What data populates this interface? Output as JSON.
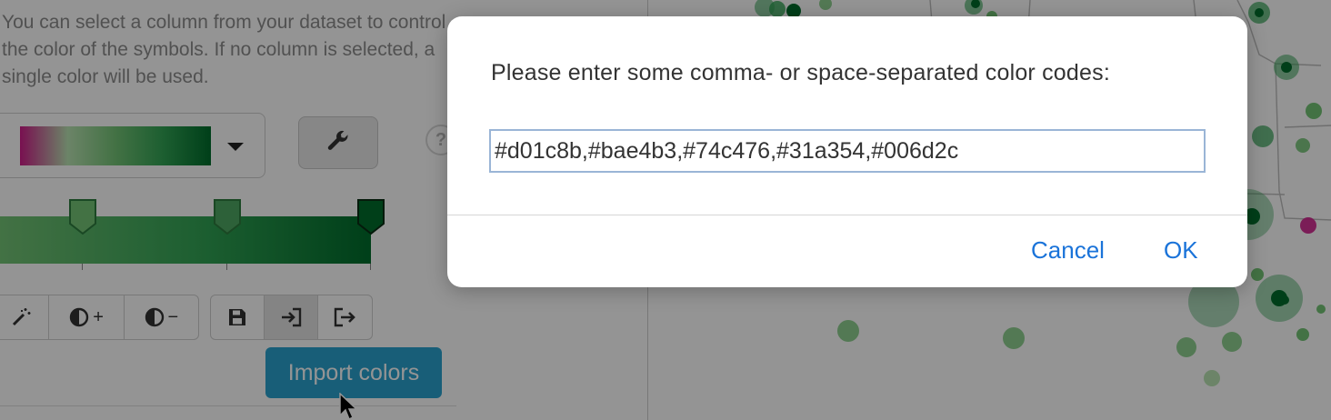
{
  "sidebar": {
    "help_text": "You can select a column from your dataset to control the color of the symbols. If no column is selected, a single color will be used.",
    "palette_gradient": [
      "#d01c8b",
      "#bae4b3",
      "#74c476",
      "#31a354",
      "#006d2c"
    ],
    "help_button_label": "?",
    "tools": {
      "magic_icon": "magic-wand-icon",
      "contrast_up_label": "+",
      "contrast_down_label": "−",
      "save_icon": "floppy-disk-icon",
      "import_icon": "import-arrow-icon",
      "export_icon": "export-arrow-icon"
    },
    "tooltip": "Import colors"
  },
  "dialog": {
    "message": "Please enter some comma- or space-separated color codes:",
    "input_value": "#d01c8b,#bae4b3,#74c476,#31a354,#006d2c",
    "cancel_label": "Cancel",
    "ok_label": "OK"
  },
  "colors": {
    "accent": "#1a73d9",
    "tooltip_bg": "#2aa2cf",
    "map_green": "#31a354",
    "map_dark_green": "#006d2c",
    "map_magenta": "#d01c8b"
  }
}
